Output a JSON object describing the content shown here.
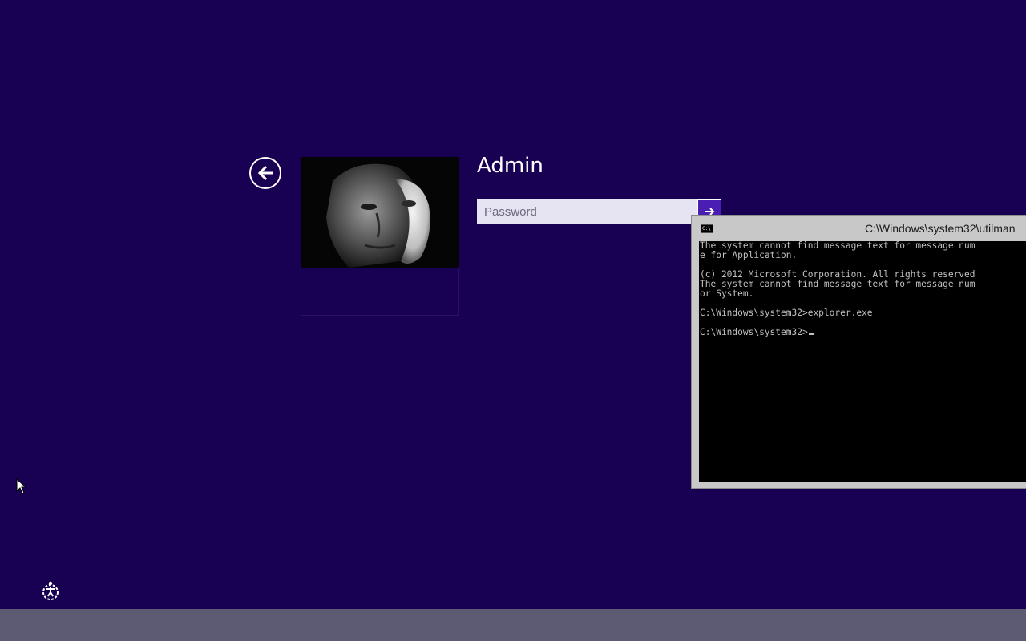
{
  "login": {
    "username": "Admin",
    "password_placeholder": "Password"
  },
  "console": {
    "title": "C:\\Windows\\system32\\utilman",
    "lines": [
      "The system cannot find message text for message num",
      "e for Application.",
      "",
      "(c) 2012 Microsoft Corporation. All rights reserved",
      "The system cannot find message text for message num",
      "or System.",
      "",
      "C:\\Windows\\system32>explorer.exe",
      "",
      "C:\\Windows\\system32>"
    ]
  },
  "icons": {
    "back": "back-arrow-icon",
    "submit": "arrow-right-icon",
    "ease_of_access": "ease-of-access-icon",
    "console": "cmd-icon",
    "pointer": "mouse-pointer-icon"
  },
  "colors": {
    "background": "#180052",
    "accent": "#4a1db3",
    "bottom_bar": "#5d5b74",
    "console_bg": "#000000",
    "console_text": "#c0c0c0"
  }
}
